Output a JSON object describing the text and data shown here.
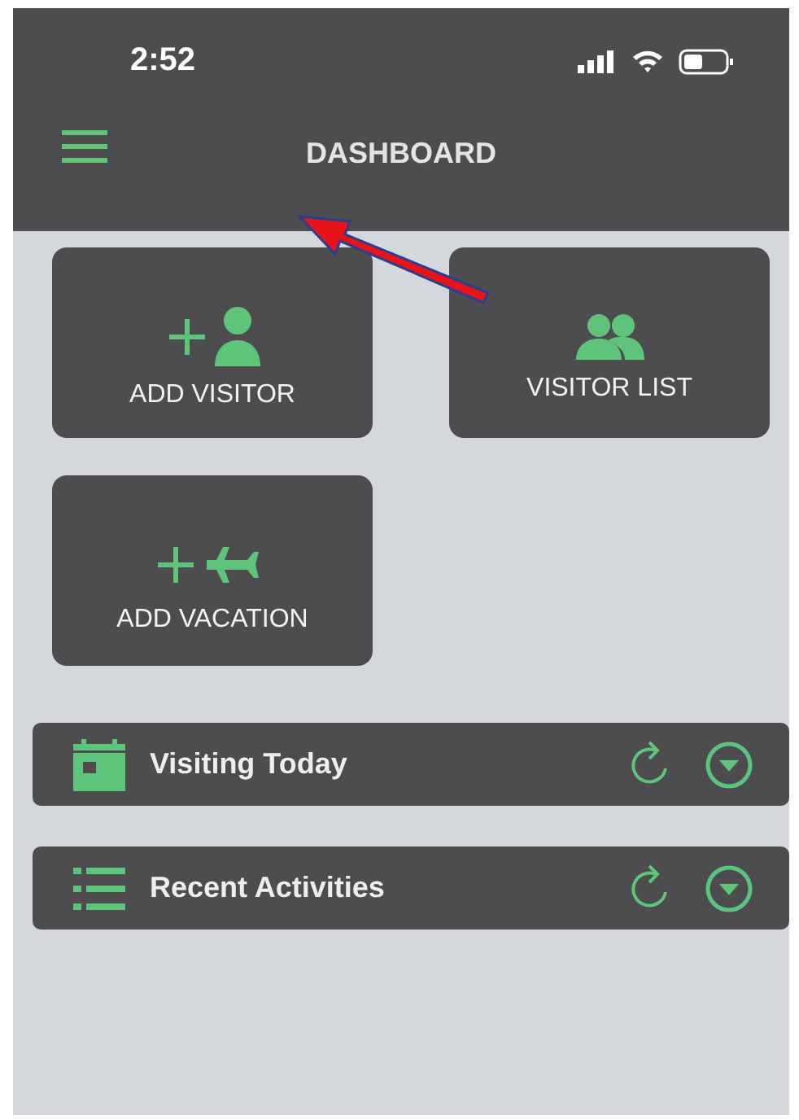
{
  "status_bar": {
    "time": "2:52"
  },
  "nav": {
    "title": "DASHBOARD"
  },
  "tiles": [
    {
      "kind": "add-person",
      "label": "ADD VISITOR"
    },
    {
      "kind": "group",
      "label": "VISITOR LIST"
    },
    {
      "kind": "add-plane",
      "label": "ADD VACATION"
    }
  ],
  "sections": [
    {
      "kind": "calendar",
      "title": "Visiting Today"
    },
    {
      "kind": "list",
      "title": "Recent Activities"
    }
  ],
  "annotation": {
    "kind": "arrow"
  }
}
